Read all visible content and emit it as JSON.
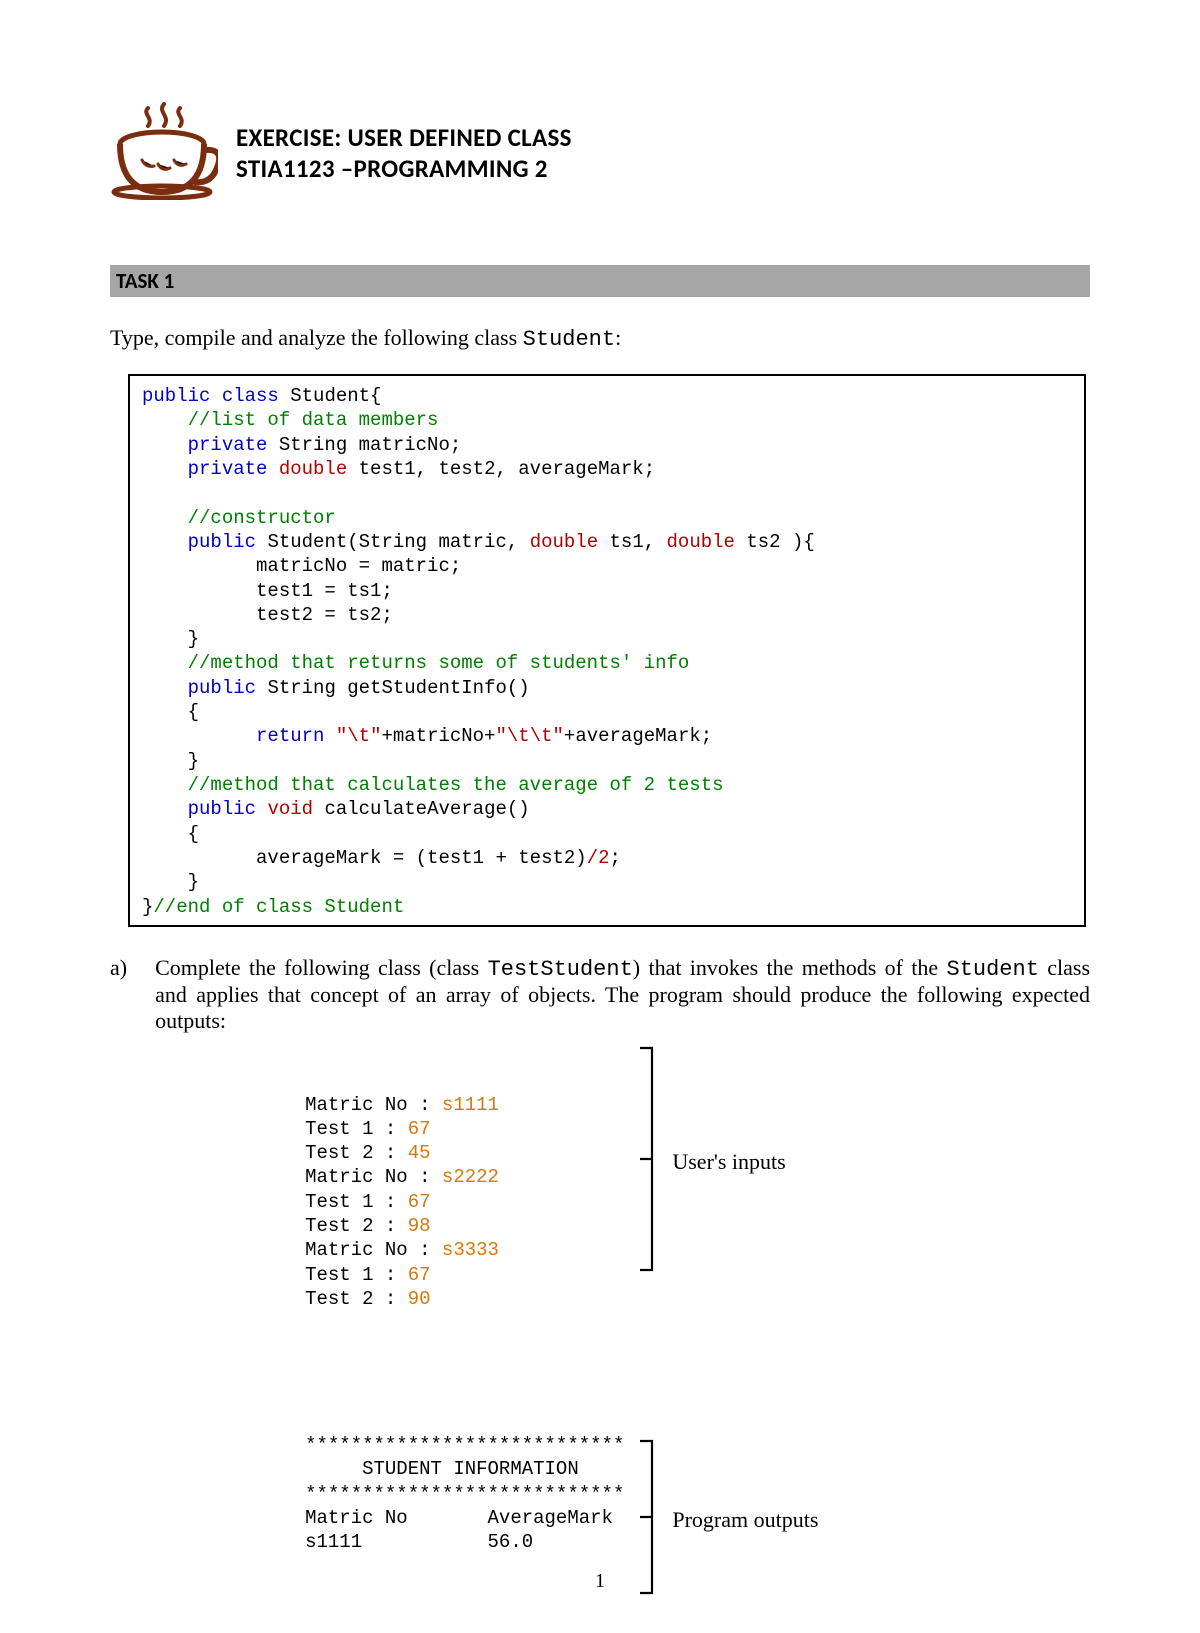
{
  "header": {
    "line1": "EXERCISE: USER DEFINED CLASS",
    "line2": "STIA1123 –PROGRAMMING 2"
  },
  "task_label": "TASK 1",
  "intro_prefix": "Type, compile and analyze the following class ",
  "intro_code": "Student",
  "intro_suffix": ":",
  "code": {
    "tokens": [
      [
        "kw-blue",
        "public class "
      ],
      [
        "pl-blk",
        "Student{\n"
      ],
      [
        "pl-blk",
        "    "
      ],
      [
        "cm-grn",
        "//list of data members\n"
      ],
      [
        "pl-blk",
        "    "
      ],
      [
        "kw-blue",
        "private "
      ],
      [
        "pl-blk",
        "String matricNo;\n"
      ],
      [
        "pl-blk",
        "    "
      ],
      [
        "kw-blue",
        "private "
      ],
      [
        "kw-red",
        "double "
      ],
      [
        "pl-blk",
        "test1, test2, averageMark;\n"
      ],
      [
        "pl-blk",
        "\n"
      ],
      [
        "pl-blk",
        "    "
      ],
      [
        "cm-grn",
        "//constructor\n"
      ],
      [
        "pl-blk",
        "    "
      ],
      [
        "kw-blue",
        "public "
      ],
      [
        "pl-blk",
        "Student(String matric, "
      ],
      [
        "kw-red",
        "double "
      ],
      [
        "pl-blk",
        "ts1, "
      ],
      [
        "kw-red",
        "double "
      ],
      [
        "pl-blk",
        "ts2 ){\n"
      ],
      [
        "pl-blk",
        "          matricNo = matric;\n"
      ],
      [
        "pl-blk",
        "          test1 = ts1;\n"
      ],
      [
        "pl-blk",
        "          test2 = ts2;\n"
      ],
      [
        "pl-blk",
        "    }\n"
      ],
      [
        "pl-blk",
        "    "
      ],
      [
        "cm-grn",
        "//method that returns some of students' info\n"
      ],
      [
        "pl-blk",
        "    "
      ],
      [
        "kw-blue",
        "public "
      ],
      [
        "pl-blk",
        "String getStudentInfo()\n"
      ],
      [
        "pl-blk",
        "    {\n"
      ],
      [
        "pl-blk",
        "          "
      ],
      [
        "kw-blue",
        "return "
      ],
      [
        "kw-red",
        "\"\\t\""
      ],
      [
        "pl-blk",
        "+matricNo+"
      ],
      [
        "kw-red",
        "\"\\t\\t\""
      ],
      [
        "pl-blk",
        "+averageMark;\n"
      ],
      [
        "pl-blk",
        "    }\n"
      ],
      [
        "pl-blk",
        "    "
      ],
      [
        "cm-grn",
        "//method that calculates the average of 2 tests\n"
      ],
      [
        "pl-blk",
        "    "
      ],
      [
        "kw-blue",
        "public "
      ],
      [
        "kw-red",
        "void "
      ],
      [
        "pl-blk",
        "calculateAverage()\n"
      ],
      [
        "pl-blk",
        "    {\n"
      ],
      [
        "pl-blk",
        "          averageMark = (test1 + test2)"
      ],
      [
        "kw-red",
        "/2"
      ],
      [
        "pl-blk",
        ";\n"
      ],
      [
        "pl-blk",
        "    }\n"
      ],
      [
        "pl-blk",
        "}"
      ],
      [
        "cm-grn",
        "//end of class Student"
      ]
    ]
  },
  "qa": {
    "label": "a)",
    "body_parts": [
      "Complete the following class (class ",
      "TestStudent",
      ") that invokes the methods of the ",
      "Student",
      " class  and applies that concept of an array of objects. The program should produce the following expected outputs:"
    ]
  },
  "outputs": {
    "inputs_label": "User's inputs",
    "outputs_label": "Program outputs",
    "input_lines": [
      [
        [
          "pl-blk",
          "Matric No : "
        ],
        [
          "out-orange",
          "s1111"
        ]
      ],
      [
        [
          "pl-blk",
          "Test 1 : "
        ],
        [
          "out-orange",
          "67"
        ]
      ],
      [
        [
          "pl-blk",
          "Test 2 : "
        ],
        [
          "out-orange",
          "45"
        ]
      ],
      [
        [
          "pl-blk",
          "Matric No : "
        ],
        [
          "out-orange",
          "s2222"
        ]
      ],
      [
        [
          "pl-blk",
          "Test 1 : "
        ],
        [
          "out-orange",
          "67"
        ]
      ],
      [
        [
          "pl-blk",
          "Test 2 : "
        ],
        [
          "out-orange",
          "98"
        ]
      ],
      [
        [
          "pl-blk",
          "Matric No : "
        ],
        [
          "out-orange",
          "s3333"
        ]
      ],
      [
        [
          "pl-blk",
          "Test 1 : "
        ],
        [
          "out-orange",
          "67"
        ]
      ],
      [
        [
          "pl-blk",
          "Test 2 : "
        ],
        [
          "out-orange",
          "90"
        ]
      ]
    ],
    "output_lines": [
      [
        [
          "pl-blk",
          "****************************"
        ]
      ],
      [
        [
          "pl-blk",
          "     STUDENT INFORMATION"
        ]
      ],
      [
        [
          "pl-blk",
          "****************************"
        ]
      ],
      [
        [
          "pl-blk",
          "Matric No       AverageMark"
        ]
      ],
      [
        [
          "pl-blk",
          "s1111           56.0"
        ]
      ]
    ]
  },
  "page_number": "1"
}
